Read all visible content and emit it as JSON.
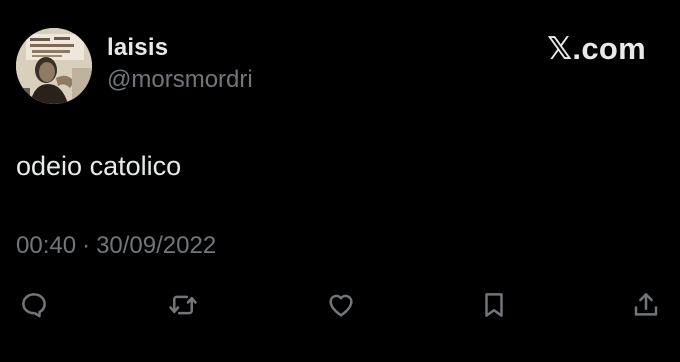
{
  "user": {
    "display_name": "laisis",
    "handle": "@morsmordri",
    "avatar_icon": "profile-photo"
  },
  "brand": {
    "label": "𝕏.com",
    "icon": "x-logo"
  },
  "tweet": {
    "text": "odeio catolico",
    "time": "00:40",
    "separator": "·",
    "date": "30/09/2022"
  },
  "actions": [
    {
      "name": "reply",
      "icon": "reply-icon"
    },
    {
      "name": "retweet",
      "icon": "retweet-icon"
    },
    {
      "name": "like",
      "icon": "heart-icon"
    },
    {
      "name": "bookmark",
      "icon": "bookmark-icon"
    },
    {
      "name": "share",
      "icon": "share-icon"
    }
  ],
  "colors": {
    "background": "#000000",
    "primary_text": "#e7e9ea",
    "secondary_text": "#71767b",
    "icon": "#71767b"
  }
}
